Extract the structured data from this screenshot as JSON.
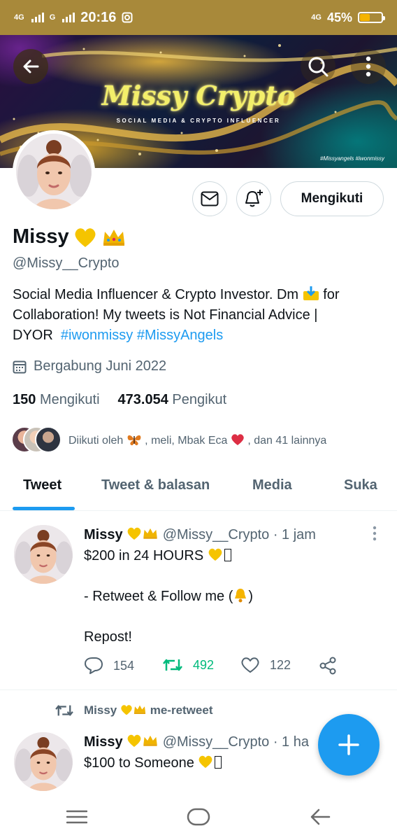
{
  "status_bar": {
    "network_1": "4G",
    "network_2": "G",
    "time": "20:16",
    "right_network": "4G",
    "battery_percent": "45%",
    "battery_level": 0.45
  },
  "banner": {
    "title": "Missy Crypto",
    "subtitle": "SOCIAL MEDIA & CRYPTO INFLUENCER",
    "tags": "#Missyangels  #iwonmissy"
  },
  "profile": {
    "follow_button_label": "Mengikuti",
    "name": "Missy",
    "handle": "@Missy__Crypto",
    "bio_line1": "Social Media Influencer & Crypto Investor. Dm",
    "bio_line1_end": "for",
    "bio_line2": "Collaboration! My tweets is Not Financial Advice |",
    "bio_line3": "DYOR",
    "hashtag_1": "#iwonmissy",
    "hashtag_2": "#MissyAngels",
    "joined": "Bergabung Juni 2022",
    "following_count": "150",
    "following_label": "Mengikuti",
    "followers_count": "473.054",
    "followers_label": "Pengikut",
    "followed_by_prefix": "Diikuti oleh",
    "followed_by_rest": ", meli, Mbak Eca",
    "followed_by_suffix": ", dan 41 lainnya"
  },
  "tabs": [
    {
      "label": "Tweet"
    },
    {
      "label": "Tweet & balasan"
    },
    {
      "label": "Media"
    },
    {
      "label": "Suka"
    }
  ],
  "tweets": [
    {
      "name": "Missy",
      "handle_time": "@Missy__Crypto · 1 jam",
      "line1": "$200 in 24 HOURS",
      "line2": "- Retweet & Follow me (",
      "line2_end": ")",
      "line3": "Repost!",
      "replies": "154",
      "retweets": "492",
      "likes": "122"
    },
    {
      "retweeted_by": "Missy",
      "retweeted_label": "me-retweet",
      "name": "Missy",
      "handle_time": "@Missy__Crypto · 1 ha",
      "line1": "$100 to Someone"
    }
  ],
  "colors": {
    "accent": "#1d9bf0",
    "status_bar": "#a8893a",
    "retweet_green": "#00ba7c"
  }
}
